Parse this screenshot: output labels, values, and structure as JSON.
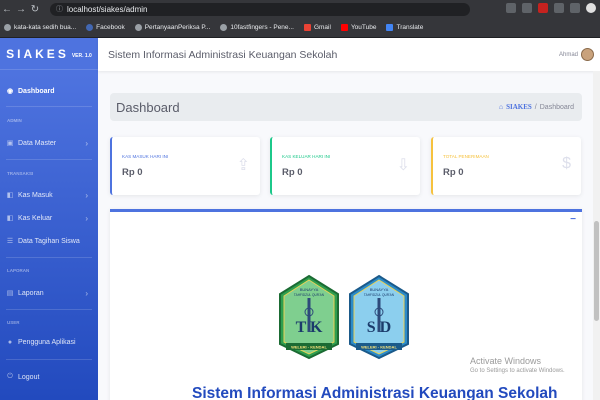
{
  "browser": {
    "url": "localhost/siakes/admin",
    "bookmarks": [
      {
        "label": "kata-kata sedih bua...",
        "icon": "page-icon"
      },
      {
        "label": "Facebook",
        "icon": "facebook-icon"
      },
      {
        "label": "PertanyaanPeriksa P...",
        "icon": "page-icon"
      },
      {
        "label": "10fastfingers - Pene...",
        "icon": "page-icon"
      },
      {
        "label": "Gmail",
        "icon": "gmail-icon"
      },
      {
        "label": "YouTube",
        "icon": "youtube-icon"
      },
      {
        "label": "Translate",
        "icon": "translate-icon"
      }
    ]
  },
  "sidebar": {
    "brand": "SIAKES",
    "version": "VER. 1.0",
    "dashboard": "Dashboard",
    "heading_admin": "ADMIN",
    "data_master": "Data Master",
    "heading_transaksi": "TRANSAKSI",
    "kas_masuk": "Kas Masuk",
    "kas_keluar": "Kas Keluar",
    "data_tagihan": "Data Tagihan Siswa",
    "heading_laporan": "LAPORAN",
    "laporan": "Laporan",
    "heading_user": "USER",
    "pengguna": "Pengguna Aplikasi",
    "logout": "Logout"
  },
  "topbar": {
    "title": "Sistem Informasi Administrasi Keuangan Sekolah",
    "user": "Ahmad"
  },
  "page": {
    "title": "Dashboard",
    "crumb_home": "SIAKES",
    "crumb_sep": "/",
    "crumb_current": "Dashboard"
  },
  "cards": [
    {
      "label": "KAS MASUK HARI INI",
      "value": "Rp 0",
      "color": "#4e73df",
      "icon": "upload-icon"
    },
    {
      "label": "KAS KELUAR HARI INI",
      "value": "Rp 0",
      "color": "#1cc88a",
      "icon": "download-icon"
    },
    {
      "label": "TOTAL PENERIMAAN",
      "value": "Rp 0",
      "color": "#f6c23e",
      "icon": "dollar-icon"
    }
  ],
  "panel": {
    "logos": [
      {
        "top": "BUNAYYA",
        "sub": "TAHFIDZUL QUR'AN",
        "letters": "T K",
        "footer": "WELERI - KENDAL"
      },
      {
        "top": "BUNAYYA",
        "sub": "TAHFIDZUL QUR'AN",
        "letters": "S D",
        "footer": "WELERI - KENDAL"
      }
    ],
    "system_name": "Sistem Informasi Administrasi Keuangan Sekolah"
  },
  "watermark": {
    "title": "Activate Windows",
    "subtitle": "Go to Settings to activate Windows."
  }
}
